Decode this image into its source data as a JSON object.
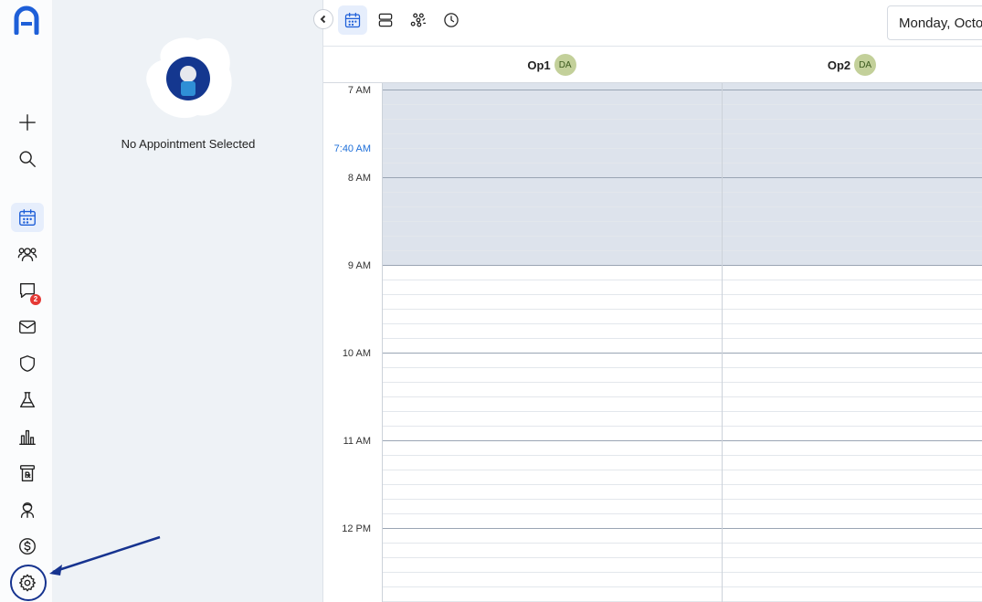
{
  "sidebar": {
    "items": [
      {
        "icon": "plus-icon"
      },
      {
        "icon": "search-icon"
      },
      {
        "icon": "calendar-icon",
        "active": true
      },
      {
        "icon": "patients-icon"
      },
      {
        "icon": "messages-icon",
        "badge": "2"
      },
      {
        "icon": "mail-icon"
      },
      {
        "icon": "shield-icon"
      },
      {
        "icon": "lab-flask-icon"
      },
      {
        "icon": "reports-chart-icon"
      },
      {
        "icon": "prescription-icon"
      },
      {
        "icon": "doctor-icon"
      },
      {
        "icon": "billing-dollar-icon"
      },
      {
        "icon": "settings-gear-icon"
      }
    ]
  },
  "panel": {
    "message": "No Appointment Selected"
  },
  "toolbar": {
    "views": [
      "day-calendar-icon",
      "rows-view-icon",
      "group-view-icon",
      "clock-icon"
    ],
    "date_label": "Monday, Octo"
  },
  "columns": [
    {
      "name": "Op1",
      "provider": "DA"
    },
    {
      "name": "Op2",
      "provider": "DA"
    }
  ],
  "times": {
    "now": "7:40 AM",
    "hours": [
      "7 AM",
      "8 AM",
      "9 AM",
      "10 AM",
      "11 AM",
      "12 PM"
    ]
  },
  "colors": {
    "accent": "#1e5fd8",
    "closed_block": "#dde3ec",
    "provider_badge": "#c3d09a",
    "badge_red": "#e53935",
    "annotation": "#16338f"
  }
}
